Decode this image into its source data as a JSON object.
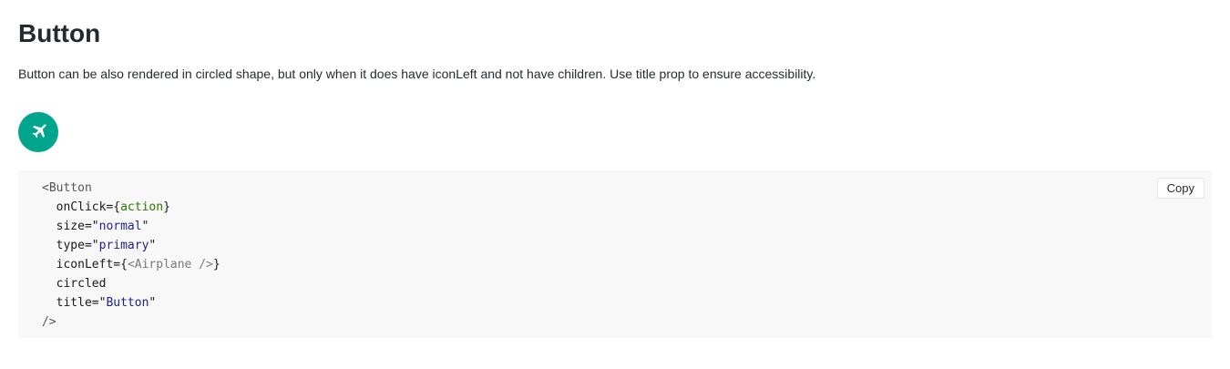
{
  "page": {
    "title": "Button",
    "description": "Button can be also rendered in circled shape, but only when it does have iconLeft and not have children. Use title prop to ensure accessibility."
  },
  "demo_button": {
    "icon": "airplane-icon",
    "title": "Button",
    "background_color": "#00a58e"
  },
  "code": {
    "copy_label": "Copy",
    "open_tag": "<Button",
    "lines": [
      {
        "attr": "onClick",
        "prefix": "={",
        "value": "action",
        "suffix": "}"
      },
      {
        "attr": "size",
        "prefix": "=\"",
        "value": "normal",
        "suffix": "\""
      },
      {
        "attr": "type",
        "prefix": "=\"",
        "value": "primary",
        "suffix": "\""
      },
      {
        "attr": "iconLeft",
        "prefix": "={",
        "value": "<Airplane />",
        "suffix": "}"
      },
      {
        "attr": "circled",
        "prefix": "",
        "value": "",
        "suffix": ""
      },
      {
        "attr": "title",
        "prefix": "=\"",
        "value": "Button",
        "suffix": "\""
      }
    ],
    "close_tag": "/>"
  }
}
